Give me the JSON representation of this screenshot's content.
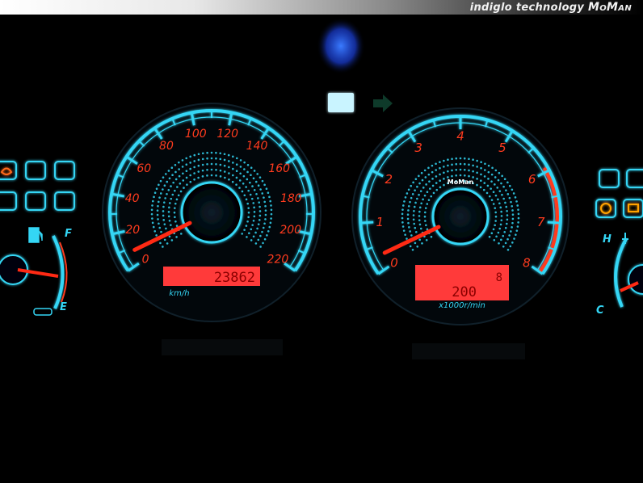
{
  "banner": {
    "prefix": "indiglo technology",
    "brand": "MoMan"
  },
  "speedometer": {
    "ticks": [
      "0",
      "20",
      "40",
      "60",
      "80",
      "100",
      "120",
      "140",
      "160",
      "180",
      "200",
      "220"
    ],
    "unit": "km/h",
    "odometer": "23862",
    "needle_value": 8
  },
  "tachometer": {
    "ticks": [
      "0",
      "1",
      "2",
      "3",
      "4",
      "5",
      "6",
      "7",
      "8"
    ],
    "brand_label": "MoMan",
    "unit": "x1000r/min",
    "lcd_top": "8",
    "lcd_bottom": "200",
    "needle_value": 0.3
  },
  "fuel_gauge": {
    "full": "F",
    "empty": "E"
  },
  "temp_gauge": {
    "hot": "H",
    "cold": "C"
  },
  "colors": {
    "glow": "#34d6f5",
    "numbers": "#ff3b1e",
    "lcd": "#ff3a3a",
    "indicator": "#ffa200"
  }
}
